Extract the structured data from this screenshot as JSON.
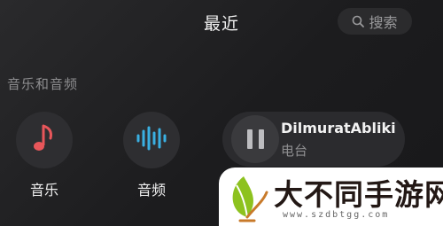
{
  "header": {
    "title": "最近",
    "search_label": "搜索"
  },
  "section": {
    "label": "音乐和音频"
  },
  "apps": [
    {
      "label": "音乐",
      "icon": "music-note-icon",
      "color": "#e8565a"
    },
    {
      "label": "音频",
      "icon": "audio-waveform-icon",
      "color": "#3ab0e2"
    }
  ],
  "now_playing": {
    "title": "DilmuratAbliki",
    "subtitle": "电台",
    "icon": "pause-icon"
  },
  "watermark": {
    "title": "大不同手游网",
    "url": "www.szdbtgg.com",
    "logo_colors": [
      "#8dc21f",
      "#c87a2a"
    ]
  }
}
